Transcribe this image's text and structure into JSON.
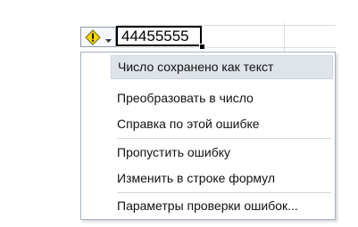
{
  "cell": {
    "value": "44455555"
  },
  "error_button": {
    "icon": "warning-icon",
    "dropdown_icon": "chevron-down-icon",
    "icon_color": "#f2d600"
  },
  "menu": {
    "header": "Число сохранено как текст",
    "items": [
      {
        "label": "Преобразовать в число"
      },
      {
        "label": "Справка по этой ошибке"
      },
      {
        "label": "Пропустить ошибку"
      },
      {
        "label": "Изменить в строке формул"
      },
      {
        "label": "Параметры проверки ошибок..."
      }
    ]
  }
}
